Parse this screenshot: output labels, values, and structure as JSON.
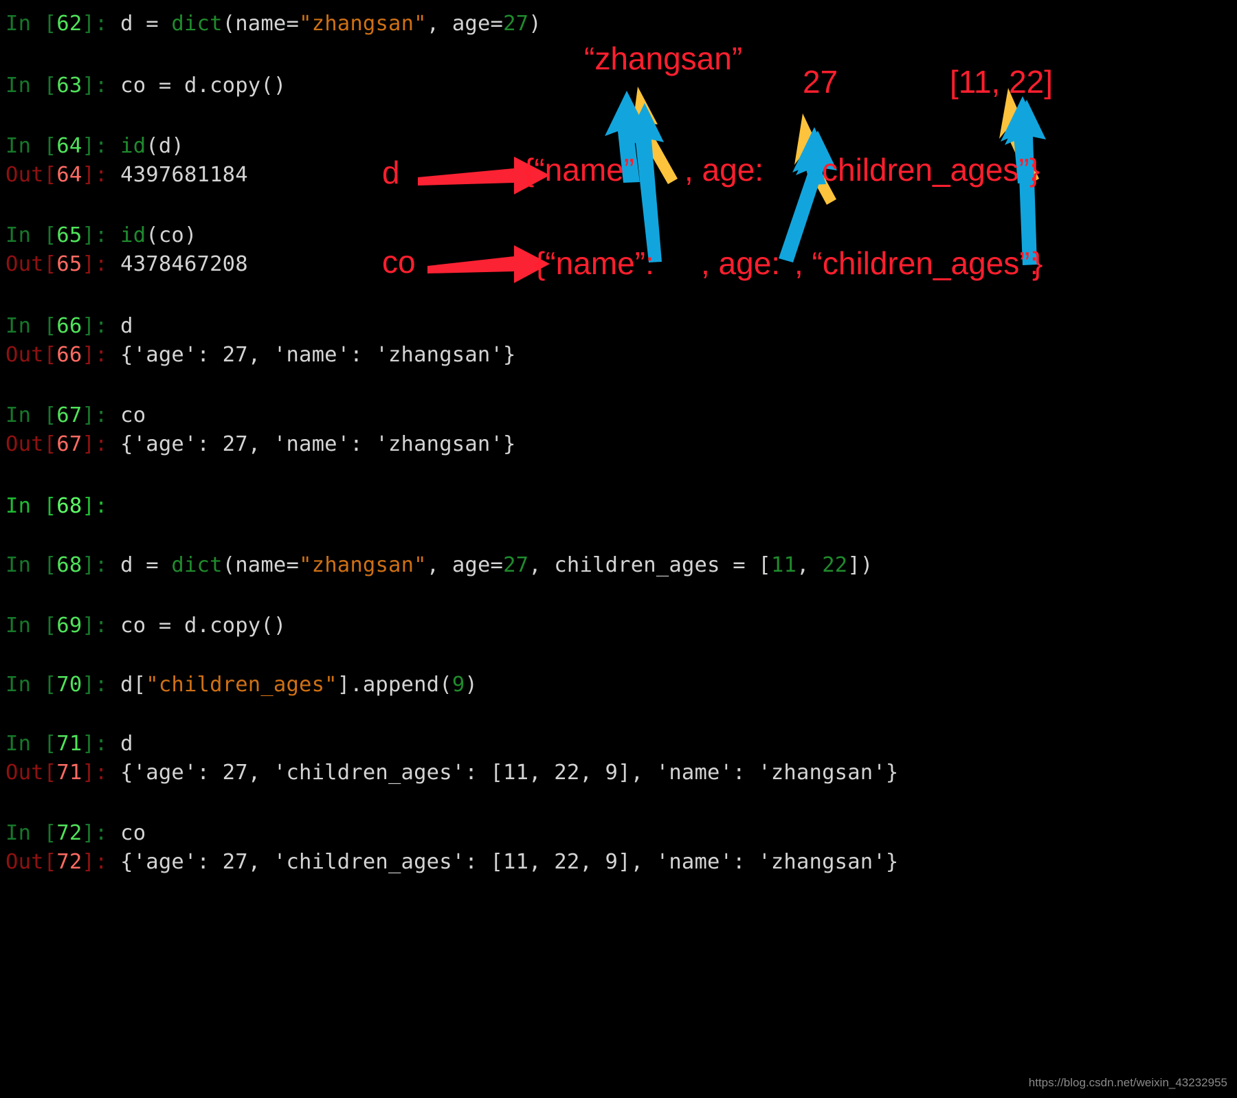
{
  "theme": {
    "background": "#000000",
    "default_text": "#d4d4d4",
    "in_prompt": "#17772a",
    "in_number": "#4fe35a",
    "out_prompt": "#8f1111",
    "out_number": "#ff6b63",
    "string": "#cf7014",
    "number": "#1f8b2d",
    "builtin": "#1f8b2d",
    "annotation_red": "#ff1f2e",
    "annotation_blue": "#12a5dd",
    "annotation_yellow": "#fdc33c"
  },
  "terminal": {
    "lines": [
      {
        "id": "in62",
        "prompt": "In",
        "num": "62",
        "code": "d = dict(name=\"zhangsan\", age=27)"
      },
      {
        "id": "in63",
        "prompt": "In",
        "num": "63",
        "code": "co = d.copy()"
      },
      {
        "id": "in64",
        "prompt": "In",
        "num": "64",
        "code": "id(d)"
      },
      {
        "id": "out64",
        "prompt": "Out",
        "num": "64",
        "code": "4397681184"
      },
      {
        "id": "in65",
        "prompt": "In",
        "num": "65",
        "code": "id(co)"
      },
      {
        "id": "out65",
        "prompt": "Out",
        "num": "65",
        "code": "4378467208"
      },
      {
        "id": "in66",
        "prompt": "In",
        "num": "66",
        "code": "d"
      },
      {
        "id": "out66",
        "prompt": "Out",
        "num": "66",
        "code": "{'age': 27, 'name': 'zhangsan'}"
      },
      {
        "id": "in67",
        "prompt": "In",
        "num": "67",
        "code": "co"
      },
      {
        "id": "out67",
        "prompt": "Out",
        "num": "67",
        "code": "{'age': 27, 'name': 'zhangsan'}"
      },
      {
        "id": "in68a",
        "prompt": "In",
        "num": "68",
        "code": ""
      },
      {
        "id": "in68b",
        "prompt": "In",
        "num": "68",
        "code": "d = dict(name=\"zhangsan\", age=27, children_ages = [11, 22])"
      },
      {
        "id": "in69",
        "prompt": "In",
        "num": "69",
        "code": "co = d.copy()"
      },
      {
        "id": "in70",
        "prompt": "In",
        "num": "70",
        "code": "d[\"children_ages\"].append(9)"
      },
      {
        "id": "in71",
        "prompt": "In",
        "num": "71",
        "code": "d"
      },
      {
        "id": "out71",
        "prompt": "Out",
        "num": "71",
        "code": "{'age': 27, 'children_ages': [11, 22, 9], 'name': 'zhangsan'}"
      },
      {
        "id": "in72",
        "prompt": "In",
        "num": "72",
        "code": "co"
      },
      {
        "id": "out72",
        "prompt": "Out",
        "num": "72",
        "code": "{'age': 27, 'children_ages': [11, 22, 9], 'name': 'zhangsan'}"
      }
    ],
    "text": {
      "in_label": "In",
      "out_label": "Out",
      "bracket_open": "[",
      "bracket_close": "]",
      "colon": ": "
    }
  },
  "annotations": {
    "labels": {
      "zhangsan_value": "“zhangsan”",
      "age_value": "27",
      "children_value": "[11, 22]",
      "d_var": "d",
      "co_var": "co",
      "d_dict_part1": "{“name”",
      "d_dict_part2": ", age:",
      "d_dict_part3": "children_ages”:",
      "d_dict_close": "}",
      "co_dict_part1": "{“name”:",
      "co_dict_part2": ", age:",
      "co_dict_part3": ", “children_ages”:",
      "co_dict_close": "}"
    },
    "arrows": {
      "red_d": "red-right-arrow",
      "red_co": "red-right-arrow",
      "blue_name_d": "blue-up-arrow",
      "blue_name_co": "blue-up-arrow",
      "blue_age_d": "blue-up-arrow",
      "blue_age_co": "blue-up-arrow",
      "blue_children_d": "blue-up-arrow",
      "blue_children_co": "blue-up-arrow",
      "yellow_name": "yellow-up-arrow",
      "yellow_age": "yellow-up-arrow",
      "yellow_children": "yellow-up-arrow"
    }
  },
  "watermark": {
    "url": "https://blog.csdn.net/weixin_43232955"
  }
}
